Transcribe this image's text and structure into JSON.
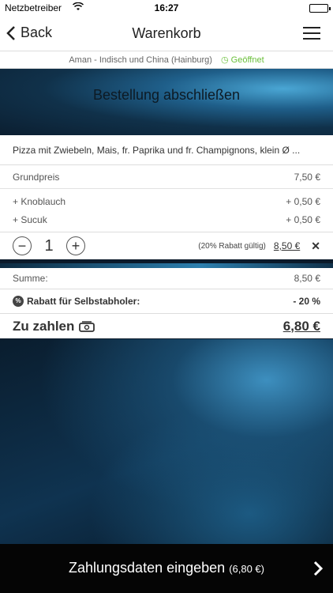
{
  "status_bar": {
    "carrier": "Netzbetreiber",
    "time": "16:27"
  },
  "nav": {
    "back_label": "Back",
    "title": "Warenkorb"
  },
  "restaurant": {
    "name": "Aman - Indisch und China (Hainburg)",
    "status": "Geöffnet"
  },
  "hero": {
    "heading": "Bestellung abschließen"
  },
  "cart_item": {
    "name": "Pizza mit Zwiebeln, Mais, fr. Paprika und fr. Champignons, klein Ø ...",
    "base_label": "Grundpreis",
    "base_price": "7,50 €",
    "extras": [
      {
        "label": "+ Knoblauch",
        "price": "+ 0,50 €"
      },
      {
        "label": "+ Sucuk",
        "price": "+ 0,50 €"
      }
    ],
    "quantity": "1",
    "discount_note": "(20% Rabatt gültig)",
    "line_total": "8,50 €"
  },
  "summary": {
    "sum_label": "Summe:",
    "sum_value": "8,50 €",
    "discount_label": "Rabatt für Selbstabholer:",
    "discount_value": "- 20 %",
    "total_label": "Zu zahlen",
    "total_value": "6,80 €"
  },
  "footer": {
    "cta_label": "Zahlungsdaten eingeben",
    "cta_amount": "(6,80 €)"
  },
  "colors": {
    "open_status": "#6abf3a",
    "footer_bg": "#050505"
  }
}
